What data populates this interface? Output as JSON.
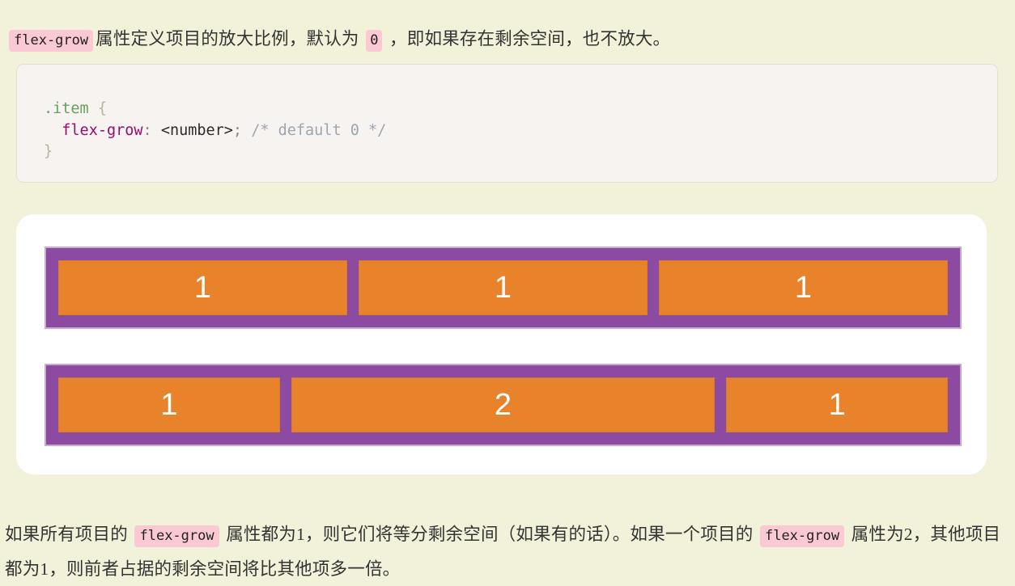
{
  "page": {
    "background_color": "#f2f1d9",
    "text_color": "#333333"
  },
  "intro_paragraph": {
    "code_chip_1": "flex-grow",
    "segment_1": "属性定义项目的放大比例，默认为",
    "code_chip_2": "0",
    "segment_2": "，即如果存在剩余空间，也不放大。"
  },
  "code_block": {
    "language": "css",
    "background_color": "#f7f3f1",
    "border_color": "#e2dfd6",
    "tokens": {
      "selector": ".item",
      "open_brace": "{",
      "property": "flex-grow",
      "colon": ":",
      "value": "<number>",
      "semicolon": ";",
      "comment": "/* default 0 */",
      "close_brace": "}"
    },
    "full_text": ".item {\n  flex-grow: <number>; /* default 0 */\n}"
  },
  "demo": {
    "card_background": "#ffffff",
    "container_color": "#8c4ba0",
    "item_color": "#e8822b",
    "item_text_color": "#ffffff",
    "rows": [
      {
        "label": "row-equal-grow",
        "items": [
          {
            "label": "1",
            "grow": 1
          },
          {
            "label": "1",
            "grow": 1
          },
          {
            "label": "1",
            "grow": 1
          }
        ]
      },
      {
        "label": "row-double-grow",
        "items": [
          {
            "label": "1",
            "grow": 1
          },
          {
            "label": "2",
            "grow": 2
          },
          {
            "label": "1",
            "grow": 1
          }
        ]
      }
    ]
  },
  "outro_paragraph": {
    "segment_1": "如果所有项目的",
    "code_chip_1": "flex-grow",
    "segment_2": "属性都为1，则它们将等分剩余空间（如果有的话）。如果一个项目的",
    "code_chip_2": "flex-grow",
    "segment_3": "属性为2，其他项目都为1，则前者占据的剩余空间将比其他项多一倍。"
  }
}
